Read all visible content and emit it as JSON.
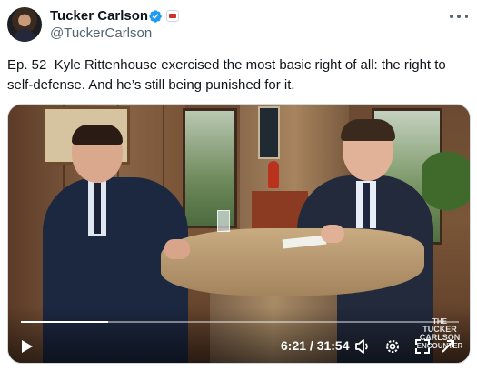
{
  "author": {
    "name": "Tucker Carlson",
    "handle": "@TuckerCarlson",
    "avatar_icon": "avatar",
    "verified_icon": "verified-badge-icon",
    "verified_color": "#1d9bf0",
    "affiliation_icon": "affiliation-badge-icon"
  },
  "more_icon": "more-options-icon",
  "tweet": {
    "text": "Ep. 52  Kyle Rittenhouse exercised the most basic right of all: the right to\nself-defense. And he’s still being punished for it."
  },
  "video": {
    "current_time": "6:21",
    "duration": "31:54",
    "time_display": "6:21 / 31:54",
    "progress": 0.199,
    "play_icon": "play-icon",
    "volume_icon": "volume-icon",
    "settings_icon": "settings-gear-icon",
    "fullscreen_icon": "fullscreen-icon",
    "watermark": {
      "line1": "THE",
      "line2": "TUCKER CARLSON",
      "line3": "ENCOUNTER"
    }
  }
}
